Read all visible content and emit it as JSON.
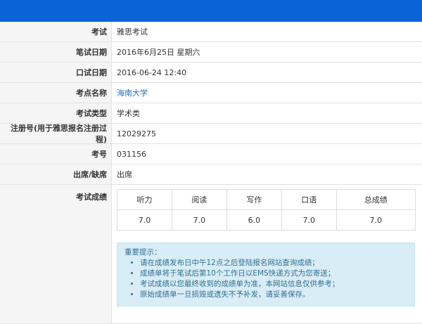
{
  "rows": {
    "exam": {
      "label": "考试",
      "value": "雅思考试"
    },
    "written_date": {
      "label": "笔试日期",
      "value": "2016年6月25日 星期六"
    },
    "oral_date": {
      "label": "口试日期",
      "value": "2016-06-24 12:40"
    },
    "venue": {
      "label": "考点名称",
      "value": "海南大学"
    },
    "exam_type": {
      "label": "考试类型",
      "value": "学术类"
    },
    "reg_no": {
      "label": "注册号(用于雅思报名注册过程)",
      "value": "12029275"
    },
    "exam_no": {
      "label": "考号",
      "value": "031156"
    },
    "attendance": {
      "label": "出席/缺席",
      "value": "出席"
    },
    "scores_label": "考试成绩"
  },
  "scores": {
    "headers": [
      "听力",
      "阅读",
      "写作",
      "口语",
      "总成绩"
    ],
    "values": [
      "7.0",
      "7.0",
      "6.0",
      "7.0",
      "7.0"
    ]
  },
  "notice": {
    "title": "重要提示：",
    "items": [
      "请在成绩发布日中午12点之后登陆报名网站查询成绩；",
      "成绩单将于笔试后第10个工作日以EMS快递方式为您寄送；",
      "考试成绩以您最终收到的成绩单为准，本网站信息仅供参考；",
      "原始成绩单一旦损毁或遗失不予补发，请妥善保存。"
    ]
  },
  "colors": {
    "header": "#0b63d8",
    "notice_bg": "#d9edf7",
    "link": "#1a6fd0"
  }
}
